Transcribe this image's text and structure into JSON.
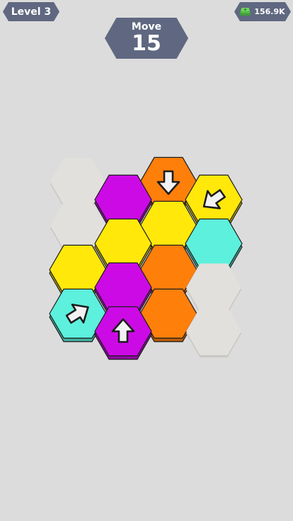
{
  "header": {
    "level_label": "Level 3",
    "move_label": "Move",
    "move_count": "15",
    "currency": "156.9K"
  },
  "colors": {
    "background": "#dcdcdc",
    "badge": "#5f6880",
    "empty_slot": "#e2e0dc",
    "orange": "#ff7f0b",
    "yellow": "#ffe80a",
    "magenta": "#cc0ae6",
    "cyan": "#5df0dc"
  },
  "board": {
    "tiles": [
      {
        "col": 0,
        "row": 0,
        "kind": "empty"
      },
      {
        "col": 0,
        "row": 1,
        "kind": "empty"
      },
      {
        "col": 0,
        "row": 2,
        "kind": "tile",
        "color": "yellow"
      },
      {
        "col": 0,
        "row": 3,
        "kind": "tile",
        "color": "cyan",
        "arrow": "up-right"
      },
      {
        "col": 1,
        "row": 0,
        "kind": "tile",
        "color": "magenta"
      },
      {
        "col": 1,
        "row": 1,
        "kind": "tile",
        "color": "yellow"
      },
      {
        "col": 1,
        "row": 2,
        "kind": "tile",
        "color": "magenta"
      },
      {
        "col": 1,
        "row": 3,
        "kind": "tile",
        "color": "magenta",
        "arrow": "up"
      },
      {
        "col": 2,
        "row": 0,
        "kind": "tile",
        "color": "orange",
        "arrow": "down"
      },
      {
        "col": 2,
        "row": 1,
        "kind": "tile",
        "color": "yellow"
      },
      {
        "col": 2,
        "row": 2,
        "kind": "tile",
        "color": "orange"
      },
      {
        "col": 2,
        "row": 3,
        "kind": "tile",
        "color": "orange"
      },
      {
        "col": 3,
        "row": 0,
        "kind": "tile",
        "color": "yellow",
        "arrow": "down-left"
      },
      {
        "col": 3,
        "row": 1,
        "kind": "tile",
        "color": "cyan"
      },
      {
        "col": 3,
        "row": 2,
        "kind": "empty"
      },
      {
        "col": 3,
        "row": 3,
        "kind": "empty"
      }
    ]
  }
}
